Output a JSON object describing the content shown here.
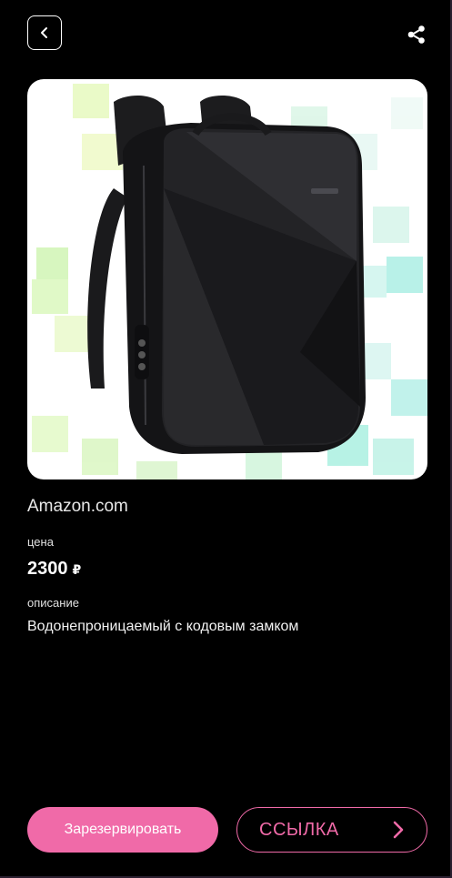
{
  "header": {
    "back_icon": "chevron-left-icon",
    "share_icon": "share-icon"
  },
  "product": {
    "image_alt": "backpack",
    "store": "Amazon.com",
    "price_label": "цена",
    "price_value": "2300",
    "currency": "₽",
    "description_label": "описание",
    "description": "Водонепроницаемый с кодовым замком"
  },
  "actions": {
    "reserve_label": "Зарезервировать",
    "link_label": "ССЫЛКА",
    "link_icon": "chevron-right-icon"
  },
  "colors": {
    "background": "#000000",
    "accent": "#f06aa8",
    "text": "#ffffff"
  }
}
